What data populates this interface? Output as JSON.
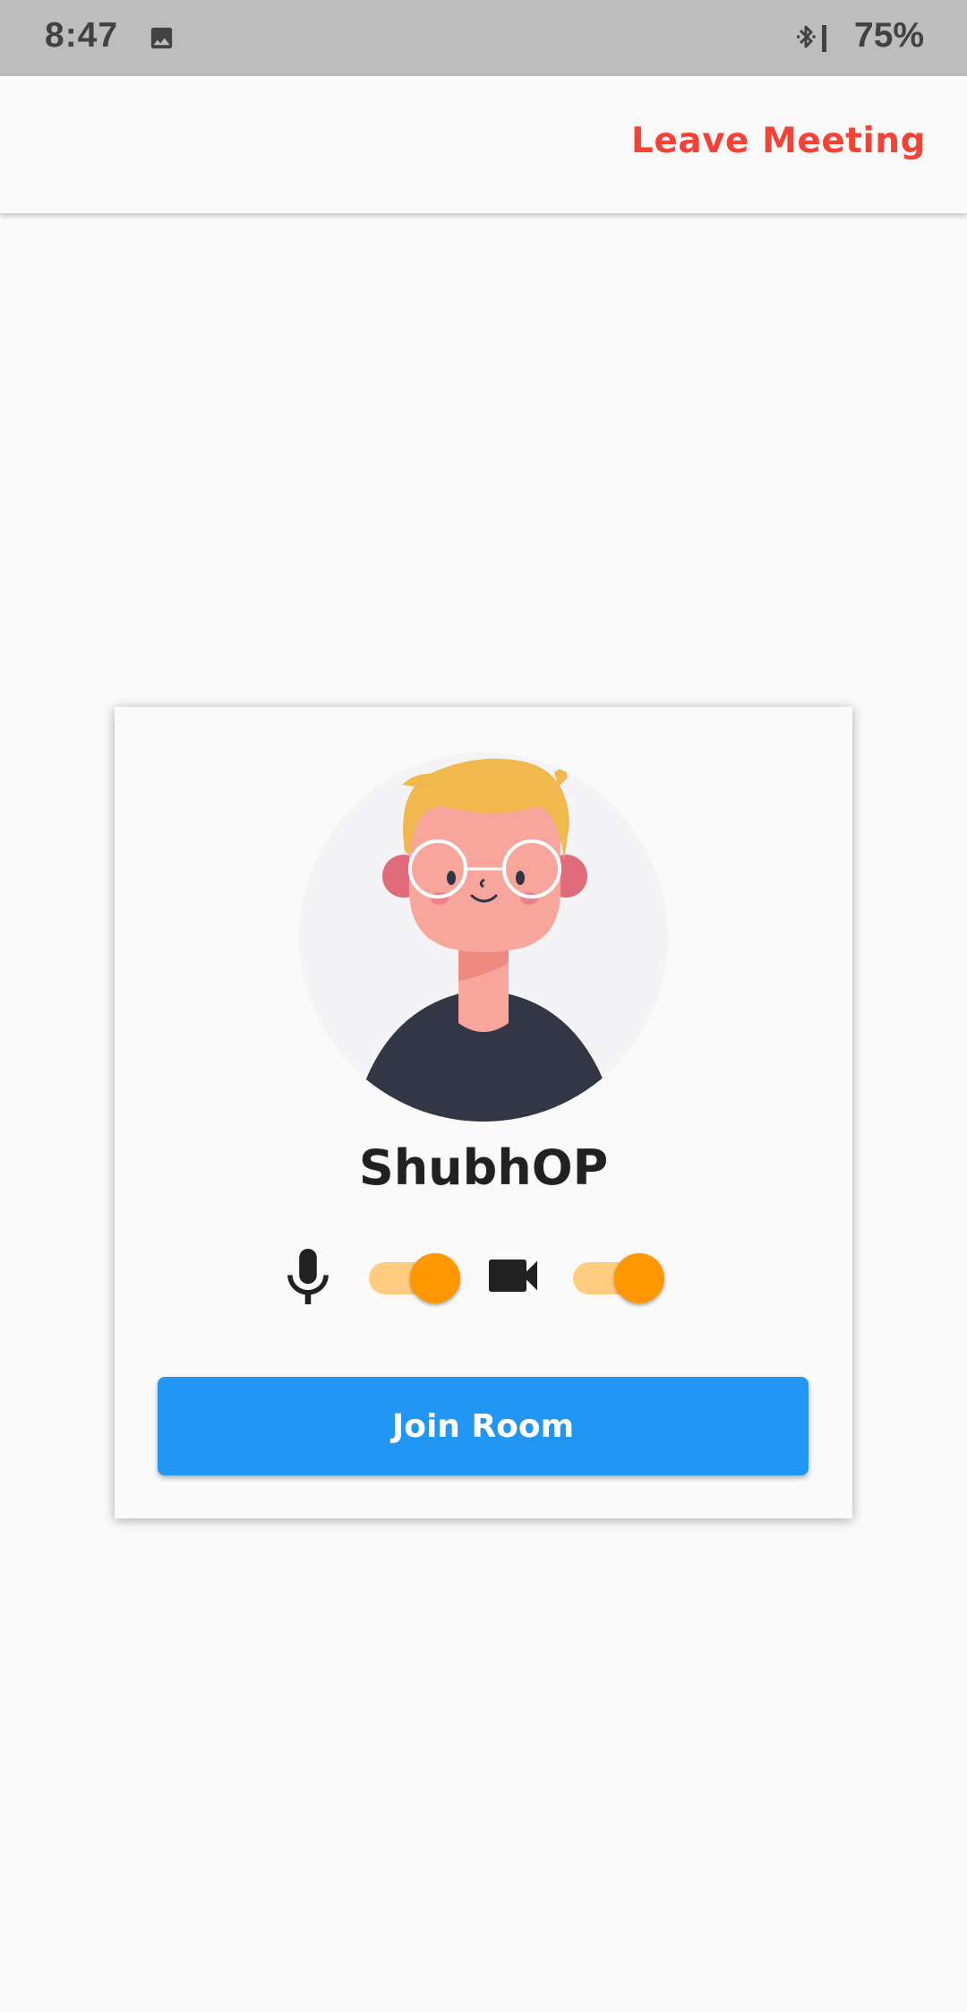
{
  "status_bar": {
    "time": "8:47",
    "battery": "75%",
    "icons": [
      "image-icon",
      "bluetooth-icon"
    ]
  },
  "app_bar": {
    "leave_label": "Leave Meeting",
    "leave_color": "#F44336"
  },
  "card": {
    "avatar_icon": "avatar-illustration",
    "user_name": "ShubhOP",
    "mic": {
      "icon": "mic-icon",
      "enabled": true
    },
    "camera": {
      "icon": "videocam-icon",
      "enabled": true
    },
    "switch_colors": {
      "thumb": "#FF9800",
      "track": "#FFCC80"
    },
    "join_label": "Join Room",
    "join_color": "#2196F3"
  }
}
